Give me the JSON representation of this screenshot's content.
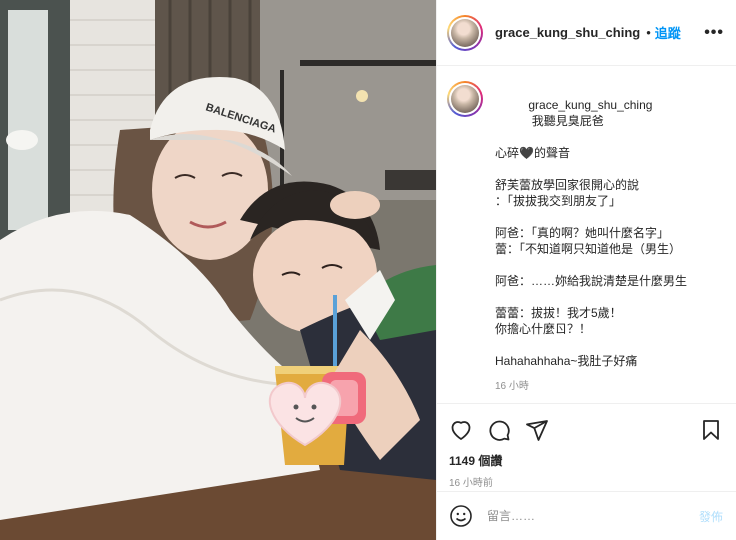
{
  "post": {
    "username": "grace_kung_shu_ching",
    "follow_label": "追蹤",
    "dot": "•",
    "more_label": "•••"
  },
  "caption": {
    "username": "grace_kung_shu_ching",
    "first_line": "我聽見臭屁爸",
    "lines": [
      "心碎🖤的聲音",
      "",
      "舒芙蕾放學回家很開心的說",
      "：「拔拔我交到朋友了」",
      "",
      "阿爸：「真的啊？她叫什麼名字」",
      "蕾：「不知道啊只知道他是（男生）",
      "",
      "阿爸：……妳給我說清楚是什麼男生",
      "",
      "蕾蕾：拔拔！我才5歲！",
      "你擔心什麼ㄖ？！",
      "",
      "Hahahahhaha~我肚子好痛"
    ],
    "time": "16 小時"
  },
  "comment": {
    "text": "▢▢▢▢▢▢▢"
  },
  "photo": {
    "cap_text": "BALENCIAGA"
  },
  "stats": {
    "likes": "1149 個讚",
    "time": "16 小時前"
  },
  "add_comment": {
    "placeholder": "留言……",
    "post_label": "發佈"
  },
  "icons": [
    "heart-icon",
    "comment-icon",
    "share-icon",
    "bookmark-icon",
    "emoji-icon",
    "more-icon"
  ],
  "colors": {
    "link": "#0095f6",
    "muted": "#8e8e8e",
    "post_disabled": "#b2dffc"
  }
}
